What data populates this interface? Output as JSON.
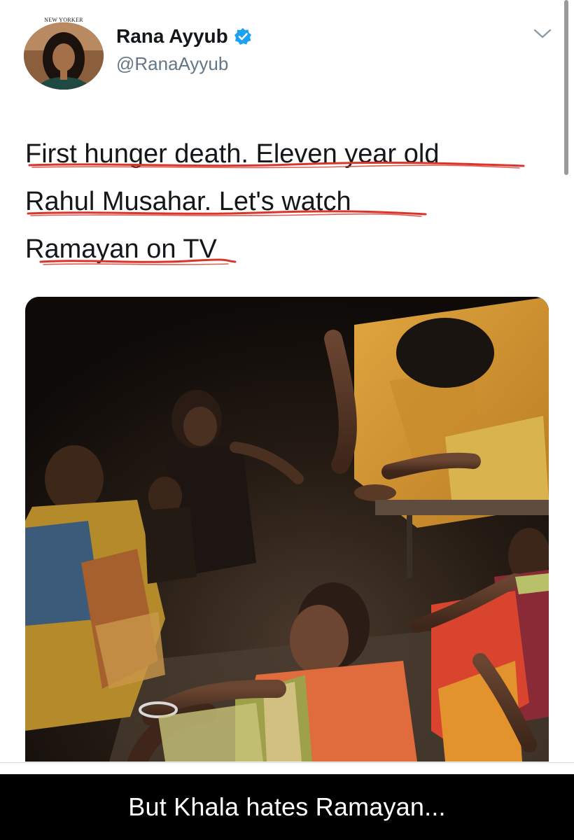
{
  "tweet": {
    "author": {
      "name": "Rana Ayyub",
      "handle": "@RanaAyyub",
      "verified": true,
      "avatar_badge_text": "NEW YORKER"
    },
    "text_lines": [
      "First hunger death. Eleven year old",
      "Rahul Musahar. Let's watch",
      "Ramayan on TV"
    ],
    "underline_color": "#d9362b",
    "verified_color": "#1da1f2",
    "photo_icon": "photo-of-grieving-family-image"
  },
  "caption": {
    "text": "But Khala hates Ramayan..."
  },
  "icons": {
    "menu": "chevron-down-icon",
    "verified": "verified-badge-icon"
  }
}
